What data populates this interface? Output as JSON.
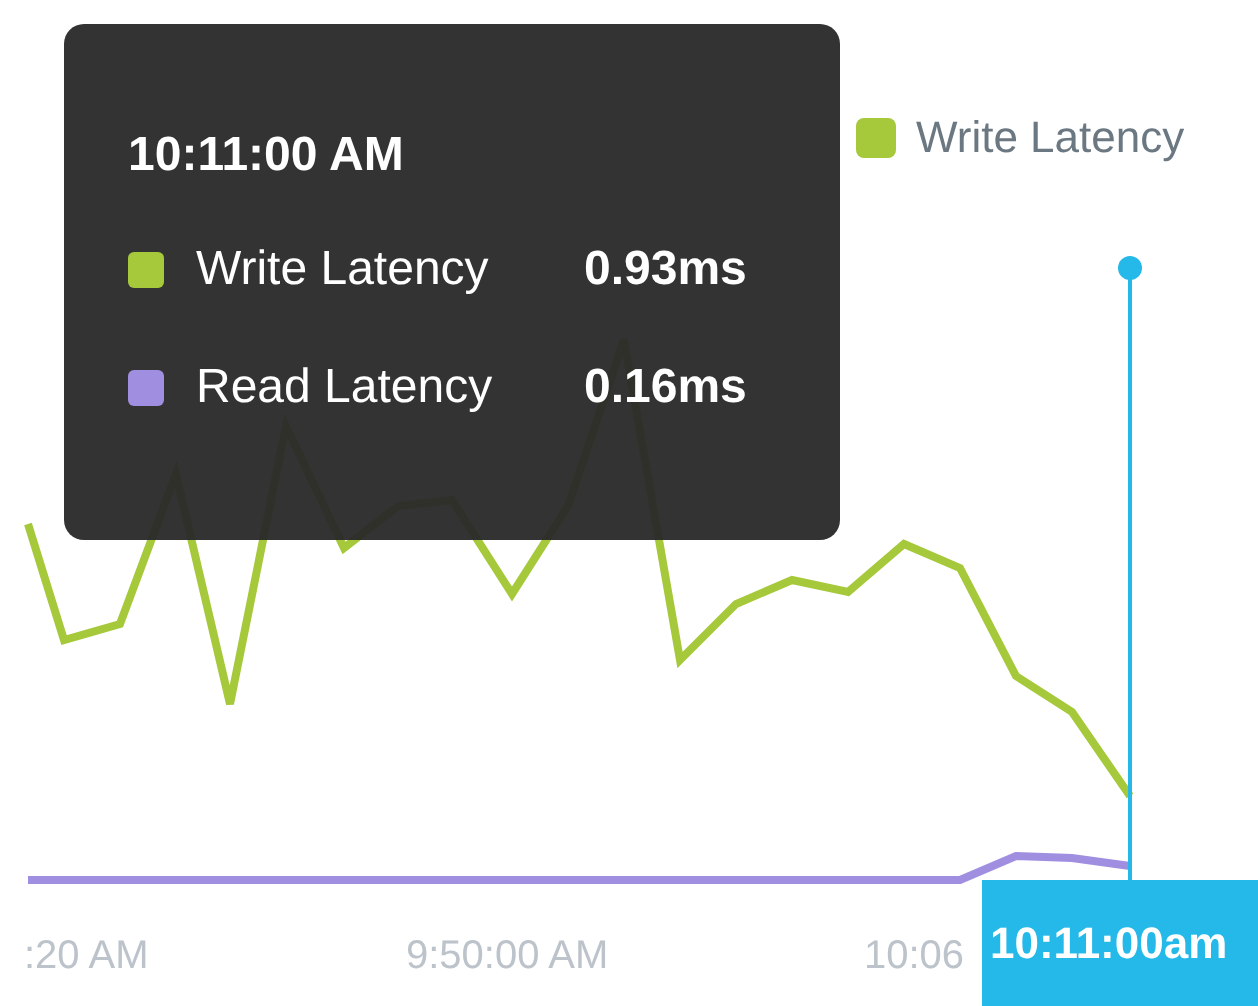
{
  "legend": [
    {
      "label": "Write Latency",
      "color": "#a5c93a"
    }
  ],
  "tooltip": {
    "title": "10:11:00 AM",
    "items": [
      {
        "label": "Write Latency",
        "value": "0.93ms",
        "color": "#a5c93a"
      },
      {
        "label": "Read Latency",
        "value": "0.16ms",
        "color": "#a08fe0"
      }
    ]
  },
  "x_axis": {
    "labels": [
      ":20 AM",
      "9:50:00 AM",
      "10:06"
    ]
  },
  "cursor": {
    "label": "10:11:00am"
  }
}
